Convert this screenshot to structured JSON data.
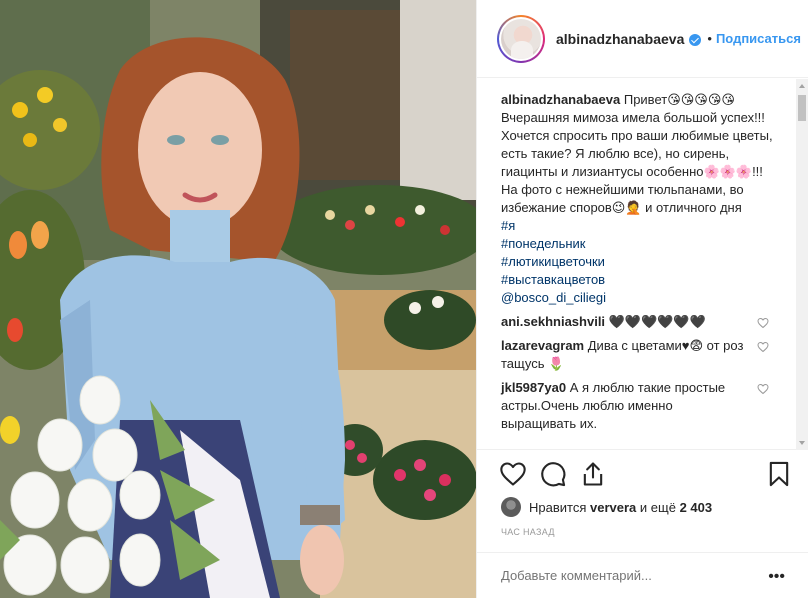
{
  "header": {
    "username": "albinadzhanabaeva",
    "separator": "•",
    "follow_label": "Подписаться"
  },
  "caption": {
    "username": "albinadzhanabaeva",
    "text": "Привет😘😘😘😘😘 Вчерашняя мимоза имела большой успех!!! Хочется спросить про ваши любимые цветы, есть такие? Я люблю все), но сирень, гиацинты и лизиантусы особенно🌸🌸🌸!!! На фото с нежнейшими тюльпанами, во избежание споров😉🤦 и отличного дня",
    "hashtags": [
      "#я",
      "#понедельник",
      "#лютикицветочки",
      "#выставкацветов"
    ],
    "mention": "@bosco_di_ciliegi"
  },
  "comments": [
    {
      "username": "ani.sekhniashvili",
      "text": "🖤🖤🖤🖤🖤🖤"
    },
    {
      "username": "lazarevagram",
      "text": "Дива с цветами♥😨 от роз тащусь 🌷"
    },
    {
      "username": "jkl5987ya0",
      "text": "А я люблю такие простые астры.Очень люблю именно выращивать их."
    }
  ],
  "actions": {
    "like_icon": "heart-icon",
    "comment_icon": "comment-icon",
    "share_icon": "share-icon",
    "save_icon": "bookmark-icon"
  },
  "likes": {
    "prefix": "Нравится",
    "user": "ververa",
    "middle": "и ещё",
    "count": "2 403"
  },
  "time_ago": "ЧАС НАЗАД",
  "add_comment": {
    "placeholder": "Добавьте комментарий...",
    "more_label": "•••"
  },
  "colors": {
    "link": "#3897f0",
    "hashtag": "#003569",
    "text": "#262626",
    "muted": "#999999",
    "border": "#efefef"
  }
}
